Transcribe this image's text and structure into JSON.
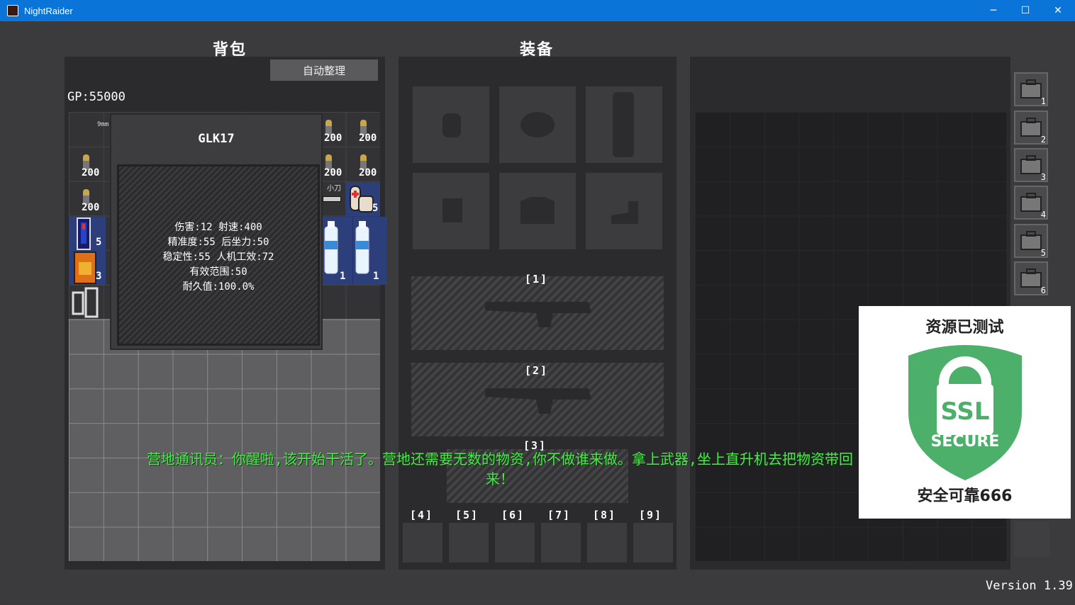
{
  "window": {
    "title": "NightRaider",
    "minimize": "─",
    "maximize": "☐",
    "close": "✕"
  },
  "backpack": {
    "heading": "背包",
    "auto_sort_label": "自动整理",
    "gp": "GP:55000",
    "item_labels": [
      "9mm",
      "小刀"
    ],
    "counts": [
      "200",
      "200",
      "200",
      "200",
      "200",
      "200",
      "5",
      "5",
      "3",
      "1",
      "1"
    ]
  },
  "tooltip": {
    "title": "GLK17",
    "stats": [
      "伤害:12   射速:400",
      "精准度:55   后坐力:50",
      "稳定性:55   人机工效:72",
      "有效范围:50",
      "耐久值:100.0%"
    ]
  },
  "equipment": {
    "heading": "装备",
    "weapon_slots": [
      "[1]",
      "[2]",
      "[3]"
    ],
    "quick_slots": [
      "[4]",
      "[5]",
      "[6]",
      "[7]",
      "[8]",
      "[9]"
    ]
  },
  "storage_tabs": [
    "1",
    "2",
    "3",
    "4",
    "5",
    "6"
  ],
  "dialog": "营地通讯员：你醒啦,该开始干活了。营地还需要无数的物资,你不做谁来做。拿上武器,坐上直升机去把物资带回来！",
  "version": "Version 1.39",
  "ssl_badge": {
    "top": "资源已测试",
    "lock_text": "SSL",
    "secure_text": "SECURE",
    "bottom": "安全可靠666"
  },
  "colors": {
    "dialog": "#4ae84a",
    "titlebar": "#0a74d8",
    "ssl_green": "#4caf6a"
  }
}
